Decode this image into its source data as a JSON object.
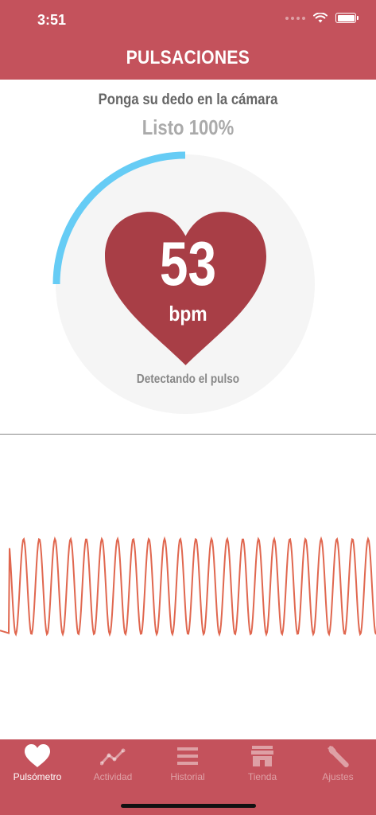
{
  "status_bar": {
    "time": "3:51"
  },
  "header": {
    "title": "PULSACIONES"
  },
  "measure": {
    "instruction": "Ponga su dedo en la cámara",
    "ready_status": "Listo 100%",
    "bpm_value": "53",
    "bpm_unit": "bpm",
    "detecting_text": "Detectando el pulso",
    "progress_fraction": 0.25
  },
  "colors": {
    "brand": "#c4525c",
    "heart": "#a83e46",
    "progress": "#66ccf5",
    "waveform": "#e0674f",
    "gauge_bg": "#f5f5f5"
  },
  "tabs": [
    {
      "label": "Pulsómetro",
      "icon": "heart-icon",
      "active": true
    },
    {
      "label": "Actividad",
      "icon": "activity-chart-icon",
      "active": false
    },
    {
      "label": "Historial",
      "icon": "list-icon",
      "active": false
    },
    {
      "label": "Tienda",
      "icon": "store-icon",
      "active": false
    },
    {
      "label": "Ajustes",
      "icon": "wrench-icon",
      "active": false
    }
  ]
}
